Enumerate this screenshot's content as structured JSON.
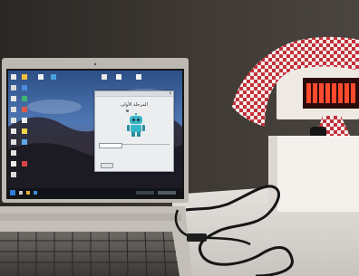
{
  "dialog": {
    "heading": "المرحلة الأولى"
  },
  "colors": {
    "wall": "#2f2b28",
    "laptop_body": "#b9b3ad",
    "screen_sky": "#3f6aa8",
    "robot_cyan": "#37b6c4",
    "headcloth_red": "#c8333b",
    "led_red": "#ff4a2e",
    "desk": "#d8d4cf"
  },
  "icons": [
    "desktop-icon",
    "start-menu-icon",
    "robot-icon",
    "cable-icon",
    "led-matrix-icon"
  ]
}
